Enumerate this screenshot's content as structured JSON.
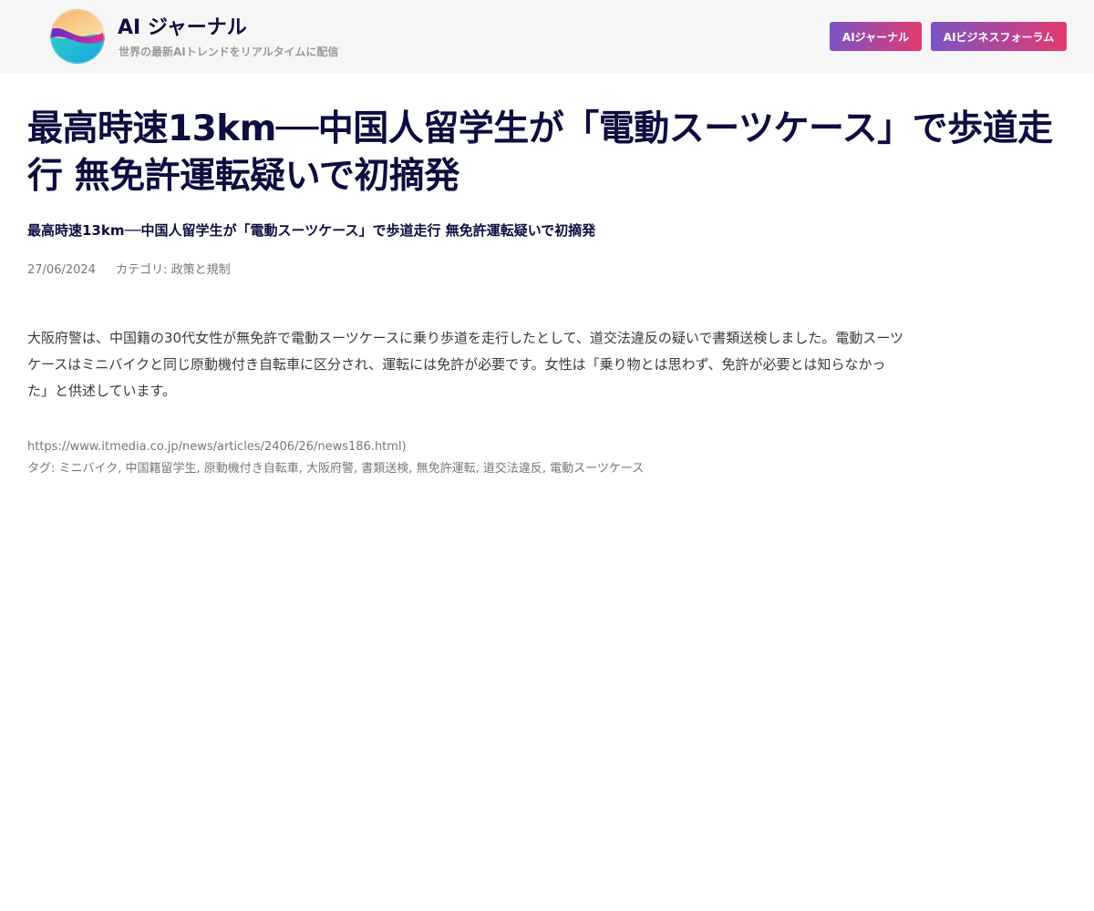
{
  "header": {
    "site_title": "AI ジャーナル",
    "tagline": "世界の最新AIトレンドをリアルタイムに配信",
    "nav": [
      {
        "label": "AIジャーナル"
      },
      {
        "label": "AIビジネスフォーラム"
      }
    ],
    "logo_icon": "gradient-swirl-logo"
  },
  "article": {
    "title": "最高時速13km──中国人留学生が「電動スーツケース」で歩道走行 無免許運転疑いで初摘発",
    "subtitle": "最高時速13km──中国人留学生が「電動スーツケース」で歩道走行 無免許運転疑いで初摘発",
    "date": "27/06/2024",
    "category": "カテゴリ: 政策と規制",
    "body": "大阪府警は、中国籍の30代女性が無免許で電動スーツケースに乗り歩道を走行したとして、道交法違反の疑いで書類送検しました。電動スーツケースはミニバイクと同じ原動機付き自転車に区分され、運転には免許が必要です。女性は「乗り物とは思わず、免許が必要とは知らなかった」と供述しています。",
    "source_url": "https://www.itmedia.co.jp/news/articles/2406/26/news186.html)",
    "tags": "タグ: ミニバイク, 中国籍留学生, 原動機付き自転車, 大阪府警, 書類送検, 無免許運転, 道交法違反, 電動スーツケース"
  },
  "colors": {
    "header_bg": "#f6f6f6",
    "title_color": "#0d0d40",
    "button_gradient_start": "#7a55c6",
    "button_gradient_end": "#e33a6e",
    "meta_color": "#777777"
  }
}
